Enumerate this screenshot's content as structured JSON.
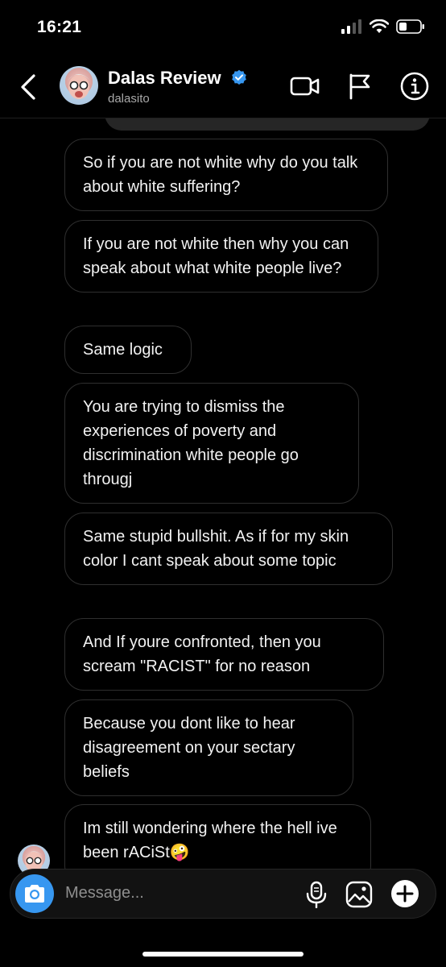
{
  "status_bar": {
    "time": "16:21"
  },
  "header": {
    "name": "Dalas Review",
    "username": "dalasito"
  },
  "messages": [
    {
      "text": "So if you are not white why do you talk about white suffering?"
    },
    {
      "text": "If you are not white then why you can speak about what white people live?"
    },
    {
      "text": "Same logic"
    },
    {
      "text": "You are trying to dismiss the experiences of poverty and discrimination white people go througj"
    },
    {
      "text": "Same stupid bullshit. As if for my skin color I cant speak about some topic"
    },
    {
      "text": "And If youre confronted, then you scream \"RACIST\" for no reason"
    },
    {
      "text": "Because you dont like to hear disagreement on your sectary beliefs"
    },
    {
      "text": "Im still wondering where the hell ive been rACiSt🤪"
    }
  ],
  "composer": {
    "placeholder": "Message..."
  },
  "colors": {
    "accent": "#3797f0",
    "bubble_border": "#2f2f2f",
    "background": "#000000"
  },
  "icons": [
    "back-chevron-icon",
    "verified-badge-icon",
    "video-call-icon",
    "flag-icon",
    "info-icon",
    "camera-icon",
    "microphone-icon",
    "gallery-icon",
    "add-icon"
  ]
}
